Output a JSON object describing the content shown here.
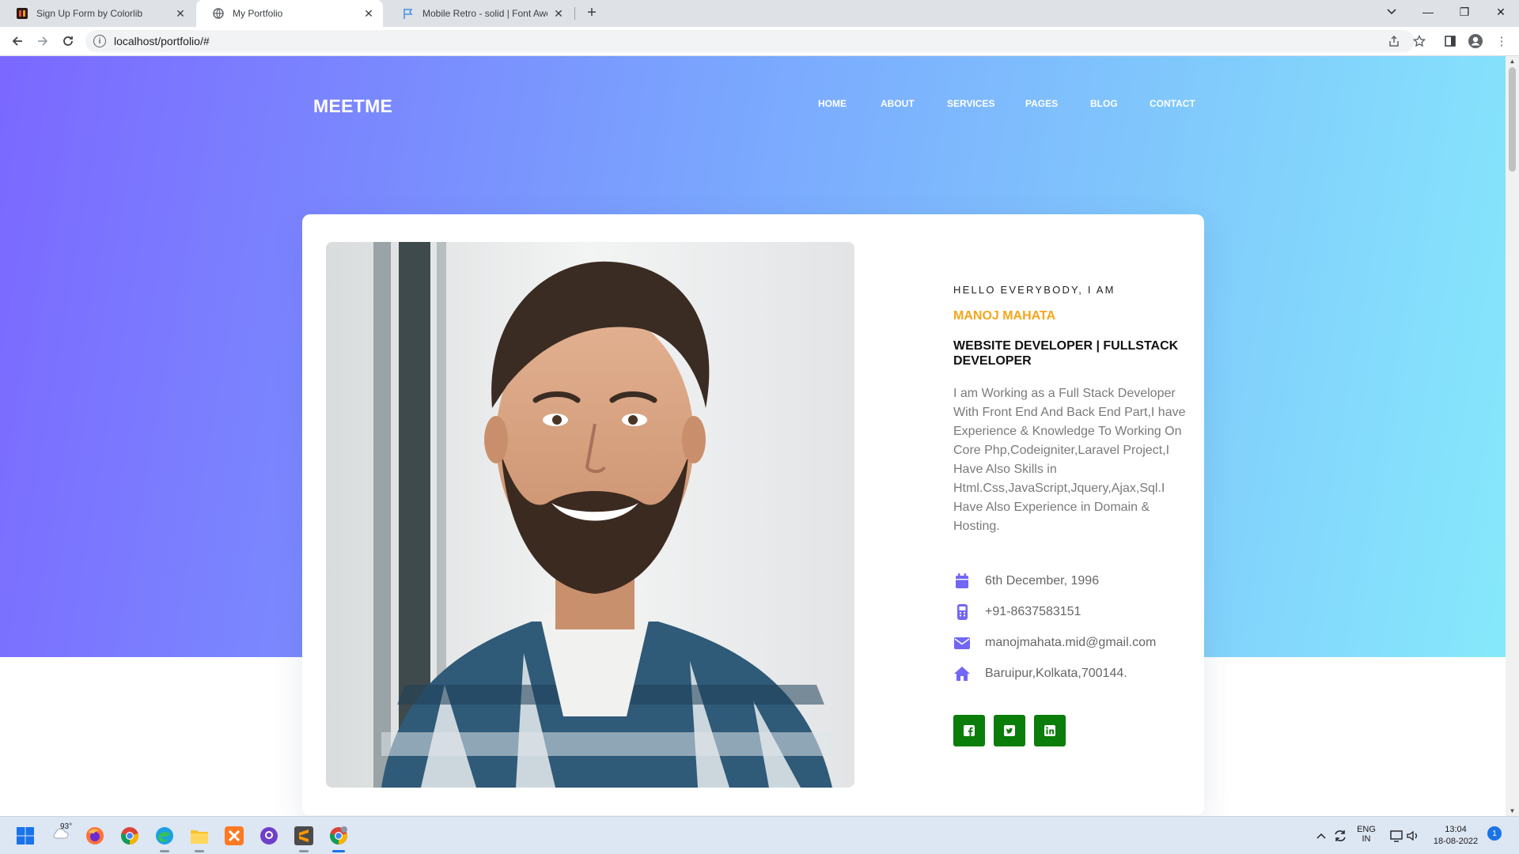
{
  "browser": {
    "tabs": [
      {
        "title": "Sign Up Form by Colorlib",
        "icon": "colorlib-icon",
        "active": false
      },
      {
        "title": "My Portfolio",
        "icon": "globe-icon",
        "active": true
      },
      {
        "title": "Mobile Retro - solid | Font Awesome",
        "icon": "flag-icon",
        "active": false
      }
    ],
    "url": "localhost/portfolio/#"
  },
  "site": {
    "logo": "MEETME",
    "nav": [
      "HOME",
      "ABOUT",
      "SERVICES",
      "PAGES",
      "BLOG",
      "CONTACT"
    ]
  },
  "profile": {
    "greeting": "HELLO EVERYBODY, I AM",
    "name": "MANOJ MAHATA",
    "role": "WEBSITE DEVELOPER | FULLSTACK DEVELOPER",
    "bio": "I am Working as a Full Stack Developer With Front End And Back End Part,I have Experience & Knowledge To Working On Core Php,Codeigniter,Laravel Project,I Have Also Skills in Html.Css,JavaScript,Jquery,Ajax,Sql.I Have Also Experience in Domain & Hosting.",
    "contacts": [
      {
        "icon": "calendar-icon",
        "text": "6th December, 1996"
      },
      {
        "icon": "mobile-retro-icon",
        "text": "+91-8637583151"
      },
      {
        "icon": "envelope-icon",
        "text": "manojmahata.mid@gmail.com"
      },
      {
        "icon": "home-icon",
        "text": "Baruipur,Kolkata,700144."
      }
    ],
    "socials": [
      "facebook-icon",
      "twitter-icon",
      "linkedin-icon"
    ]
  },
  "taskbar": {
    "weather": "93°",
    "lang_top": "ENG",
    "lang_bottom": "IN",
    "time": "13:04",
    "date": "18-08-2022",
    "notifications": "1"
  },
  "colors": {
    "accent_name": "#f4a51c",
    "social_bg": "#0a7d0a",
    "contact_icon": "#7266f5",
    "hero_start": "#7b68ff",
    "hero_end": "#86e9fb"
  }
}
